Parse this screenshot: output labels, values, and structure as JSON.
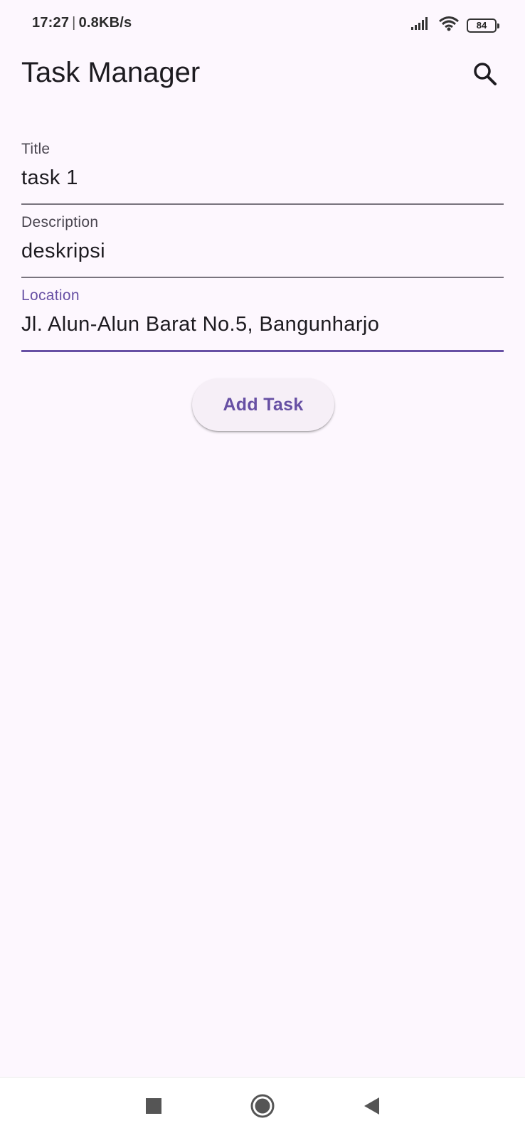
{
  "status_bar": {
    "time": "17:27",
    "separator": "|",
    "network_speed": "0.8KB/s",
    "battery_level": "84",
    "icons": [
      "signal-icon",
      "wifi-icon",
      "battery-icon"
    ]
  },
  "app_bar": {
    "title": "Task Manager",
    "search_icon": "search-icon"
  },
  "form": {
    "title": {
      "label": "Title",
      "value": "task 1"
    },
    "description": {
      "label": "Description",
      "value": "deskripsi"
    },
    "location": {
      "label": "Location",
      "value": "Jl. Alun-Alun Barat No.5, Bangunharjo"
    },
    "add_button_label": "Add Task"
  },
  "navigation": {
    "icons": [
      "recents-icon",
      "home-icon",
      "back-icon"
    ]
  },
  "colors": {
    "background": "#fdf7fe",
    "accent": "#6750a4",
    "underline": "#79747e"
  }
}
